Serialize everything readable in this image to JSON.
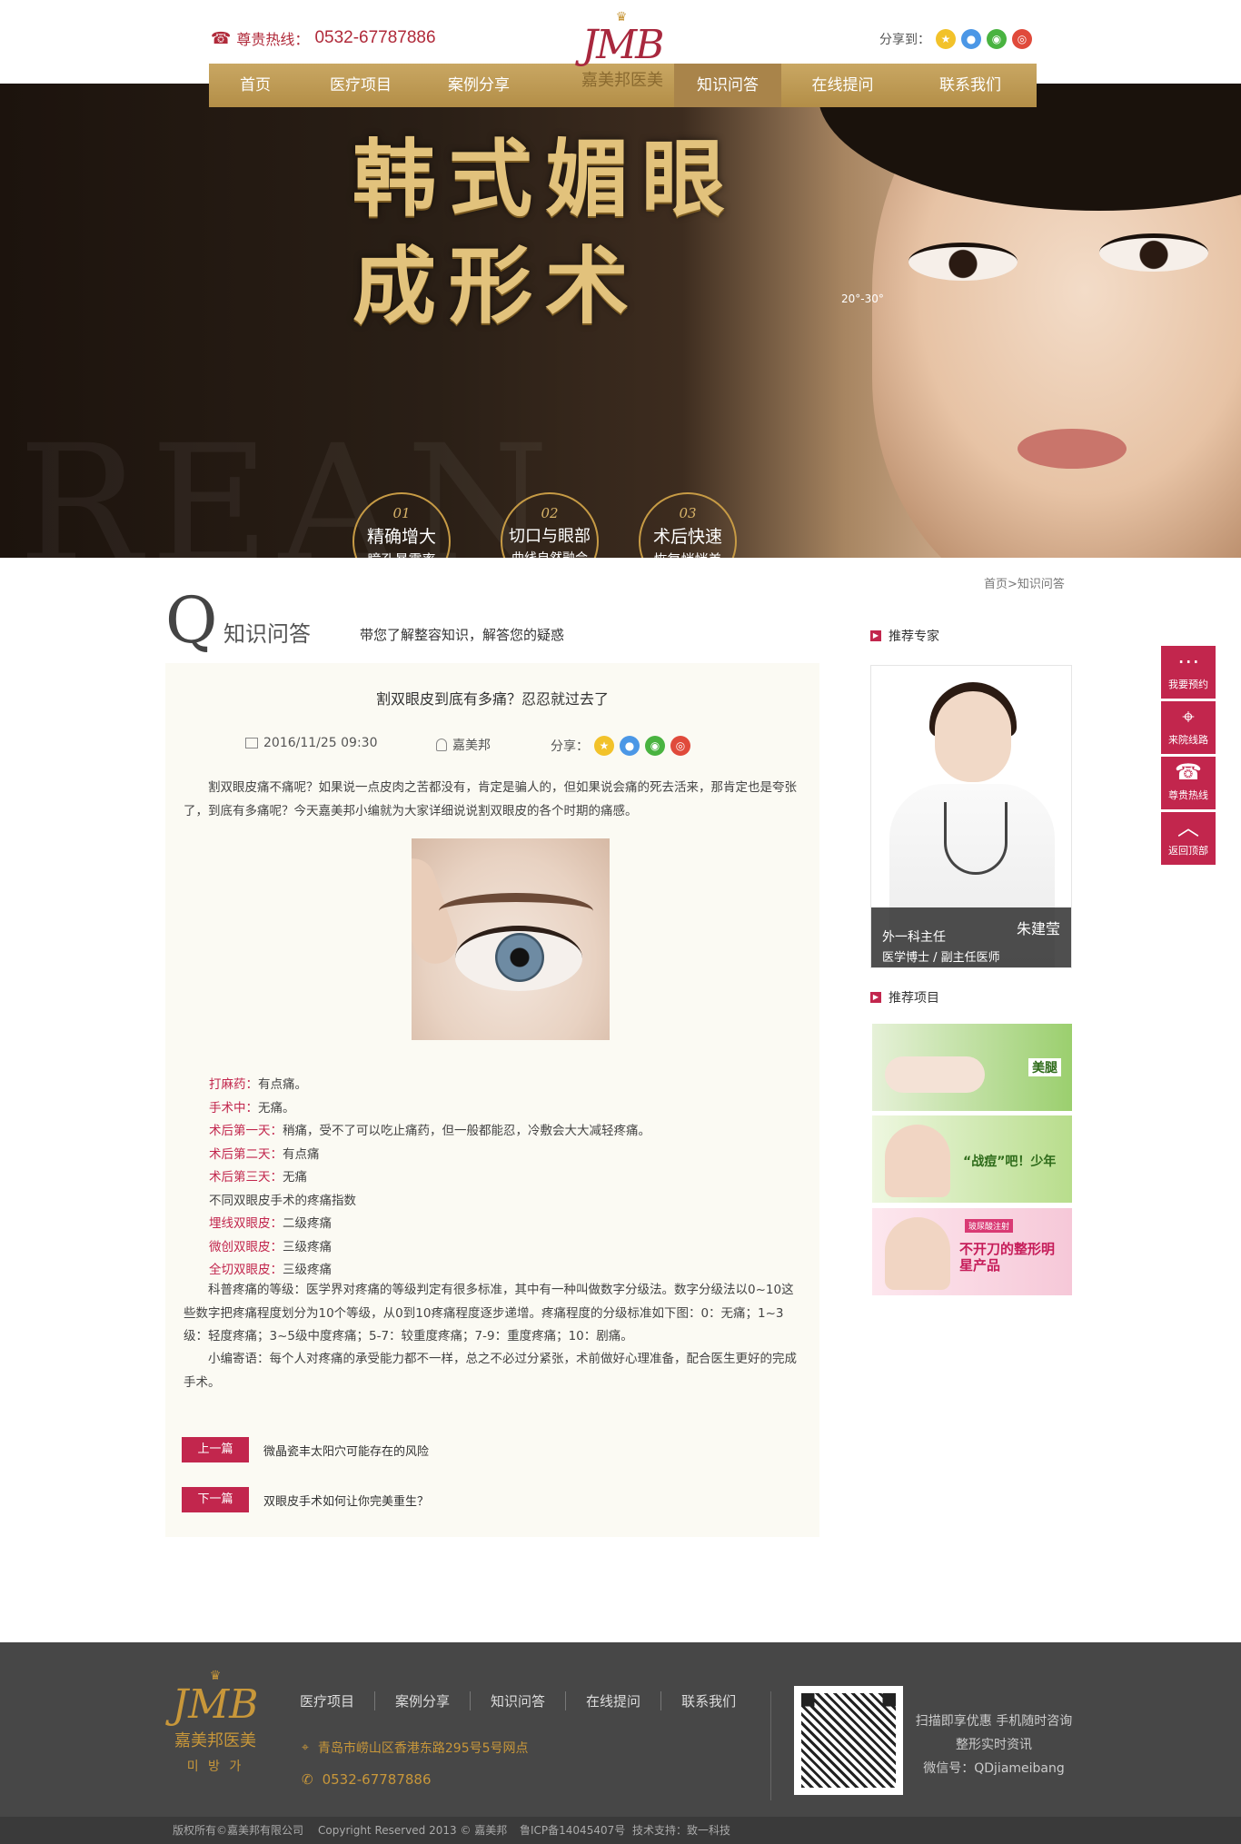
{
  "header": {
    "hotline_label": "尊贵热线：",
    "hotline_number": "0532-67787886",
    "share_label": "分享到："
  },
  "logo": {
    "crown": "♛",
    "letters": "JMB",
    "brand": "嘉美邦医美"
  },
  "nav": {
    "items": [
      "首页",
      "医疗项目",
      "案例分享",
      "知识问答",
      "在线提问",
      "联系我们"
    ],
    "active": "知识问答"
  },
  "banner": {
    "title_line1": "韩式媚眼",
    "title_line2": "成形术",
    "angle_label": "20°-30°",
    "features": [
      {
        "num": "01",
        "main": "精确增大",
        "sub": "瞳孔暴露率"
      },
      {
        "num": "02",
        "main": "切口与眼部",
        "sub": "曲线自然融合"
      },
      {
        "num": "03",
        "main": "术后快速",
        "sub": "恢复悄悄美"
      }
    ]
  },
  "breadcrumb": "首页>知识问答",
  "section": {
    "letter": "Q",
    "title": "知识问答",
    "subtitle": "带您了解整容知识，解答您的疑惑"
  },
  "article": {
    "title": "割双眼皮到底有多痛？忍忍就过去了",
    "date": "2016/11/25  09:30",
    "author": "嘉美邦",
    "share_label": "分享：",
    "intro": "割双眼皮痛不痛呢？如果说一点皮肉之苦都没有，肯定是骗人的，但如果说会痛的死去活来，那肯定也是夸张了，到底有多痛呢？今天嘉美邦小编就为大家详细说说割双眼皮的各个时期的痛感。",
    "pain_items": [
      {
        "label": "打麻药：",
        "text": "有点痛。"
      },
      {
        "label": "手术中：",
        "text": "无痛。"
      },
      {
        "label": "术后第一天：",
        "text": "稍痛，受不了可以吃止痛药，但一般都能忍，冷敷会大大减轻疼痛。"
      },
      {
        "label": "术后第二天：",
        "text": "有点痛"
      },
      {
        "label": "术后第三天：",
        "text": "无痛"
      },
      {
        "label": "",
        "text": "不同双眼皮手术的疼痛指数"
      },
      {
        "label": "埋线双眼皮：",
        "text": "二级疼痛"
      },
      {
        "label": "微创双眼皮：",
        "text": "三级疼痛"
      },
      {
        "label": "全切双眼皮：",
        "text": "三级疼痛"
      }
    ],
    "body": "科普疼痛的等级：医学界对疼痛的等级判定有很多标准，其中有一种叫做数字分级法。数字分级法以0~10这些数字把疼痛程度划分为10个等级，从0到10疼痛程度逐步递增。疼痛程度的分级标准如下图：0：无痛；1~3级：轻度疼痛；3~5级中度疼痛；5-7：较重度疼痛；7-9：重度疼痛；10：剧痛。",
    "note": "小编寄语：每个人对疼痛的承受能力都不一样，总之不必过分紧张，术前做好心理准备，配合医生更好的完成手术。",
    "prev_label": "上一篇",
    "prev_title": "微晶瓷丰太阳穴可能存在的风险",
    "next_label": "下一篇",
    "next_title": "双眼皮手术如何让你完美重生？"
  },
  "sidebar": {
    "expert_heading": "推荐专家",
    "expert": {
      "name": "朱建莹",
      "dept": "外一科主任",
      "title": "医学博士 / 副主任医师"
    },
    "project_heading": "推荐项目",
    "promos": [
      {
        "text": "美腿"
      },
      {
        "text": "“战痘”吧！少年"
      },
      {
        "badge": "玻尿酸注射",
        "text": "不开刀的整形明星产品"
      }
    ]
  },
  "float_bar": [
    {
      "icon": "chat-icon",
      "glyph": "💬",
      "label": "我要预约"
    },
    {
      "icon": "location-icon",
      "glyph": "⌖",
      "label": "来院线路"
    },
    {
      "icon": "phone-icon",
      "glyph": "☎",
      "label": "尊贵热线"
    },
    {
      "icon": "up-arrow-icon",
      "glyph": "︿",
      "label": "返回顶部"
    }
  ],
  "footer": {
    "logo_korean": "미 방 가",
    "nav": [
      "医疗项目",
      "案例分享",
      "知识问答",
      "在线提问",
      "联系我们"
    ],
    "address": "青岛市崂山区香港东路295号5号网点",
    "phone": "0532-67787886",
    "qr_line1": "扫描即享优惠 手机随时咨询",
    "qr_line2": "整形实时资讯",
    "qr_line3": "微信号：QDjiameibang",
    "copyright": "版权所有©嘉美邦有限公司",
    "copyright2": "Copyright Reserved 2013 © 嘉美邦",
    "icp": "鲁ICP备14045407号",
    "support": "技术支持：致一科技"
  },
  "colors": {
    "accent": "#c2264d",
    "gold": "#b89352",
    "footer_bg": "#474747"
  }
}
